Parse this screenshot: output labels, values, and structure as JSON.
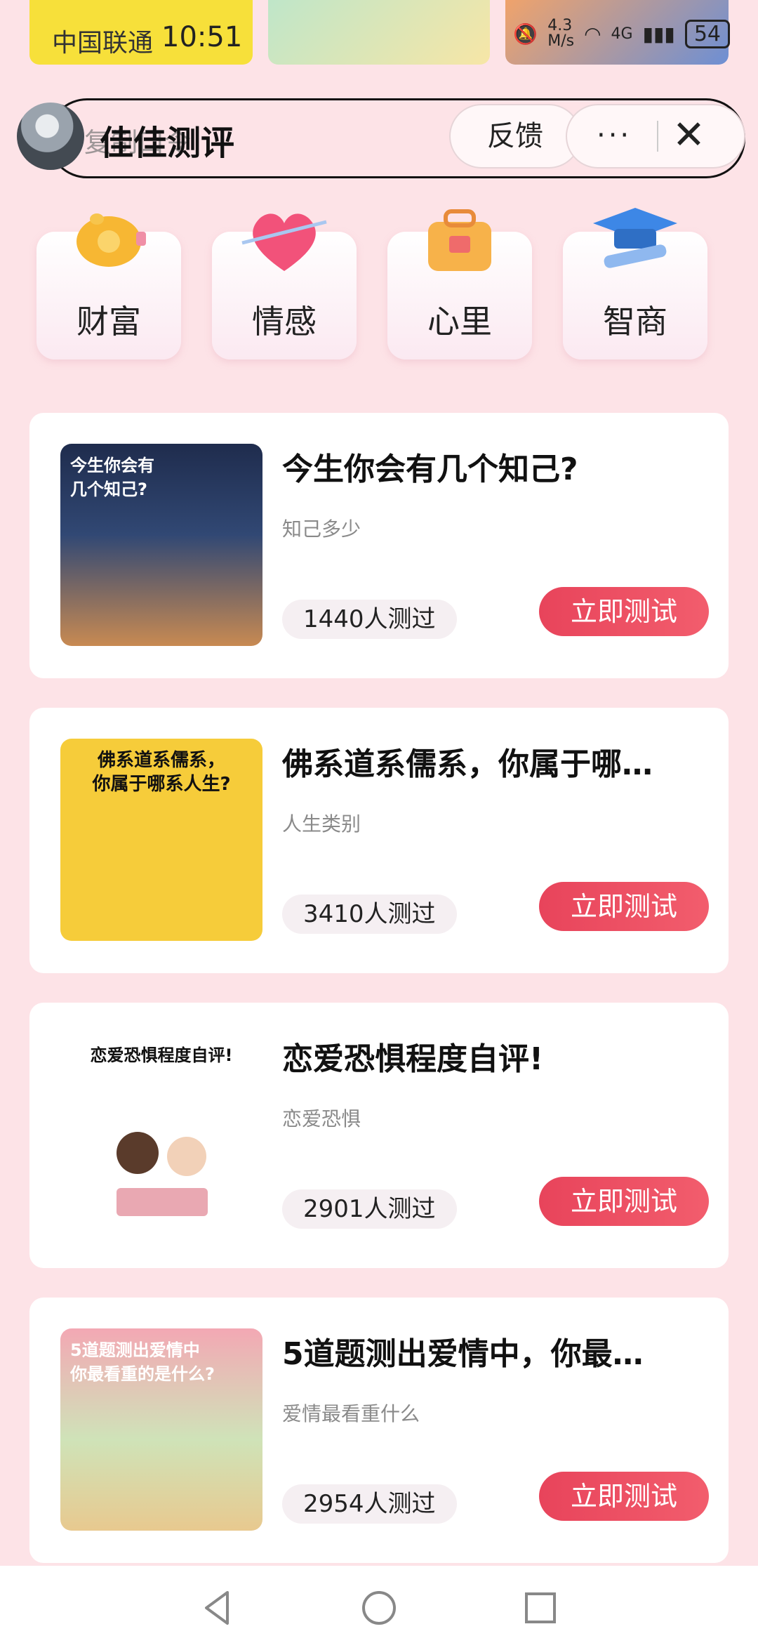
{
  "status_bar": {
    "carrier": "中国联通",
    "time": "10:51",
    "speed": "4.3\nM/s",
    "network": "4G",
    "battery": "54"
  },
  "header": {
    "title": "佳佳测评",
    "ghost_text": "复制口令",
    "feedback_label": "反馈",
    "more_label": "···",
    "close_label": "✕"
  },
  "categories": [
    {
      "label": "财富",
      "icon": "piggy-bank-icon"
    },
    {
      "label": "情感",
      "icon": "heart-icon"
    },
    {
      "label": "心里",
      "icon": "suitcase-icon"
    },
    {
      "label": "智商",
      "icon": "graduation-cap-icon"
    }
  ],
  "cards": [
    {
      "title": "今生你会有几个知己?",
      "subtitle": "知己多少",
      "count": "1440人测过",
      "button": "立即测试",
      "thumb_caption": "今生你会有\n几个知己?"
    },
    {
      "title": "佛系道系儒系，你属于哪…",
      "subtitle": "人生类别",
      "count": "3410人测过",
      "button": "立即测试",
      "thumb_caption": "佛系道系儒系，\n你属于哪系人生?"
    },
    {
      "title": "恋爱恐惧程度自评!",
      "subtitle": "恋爱恐惧",
      "count": "2901人测过",
      "button": "立即测试",
      "thumb_caption": "恋爱恐惧程度自评!"
    },
    {
      "title": "5道题测出爱情中，你最…",
      "subtitle": "爱情最看重什么",
      "count": "2954人测过",
      "button": "立即测试",
      "thumb_caption": "5道题测出爱情中\n你最看重的是什么?"
    }
  ],
  "colors": {
    "accent": "#e8445b",
    "background": "#fde3e7"
  }
}
